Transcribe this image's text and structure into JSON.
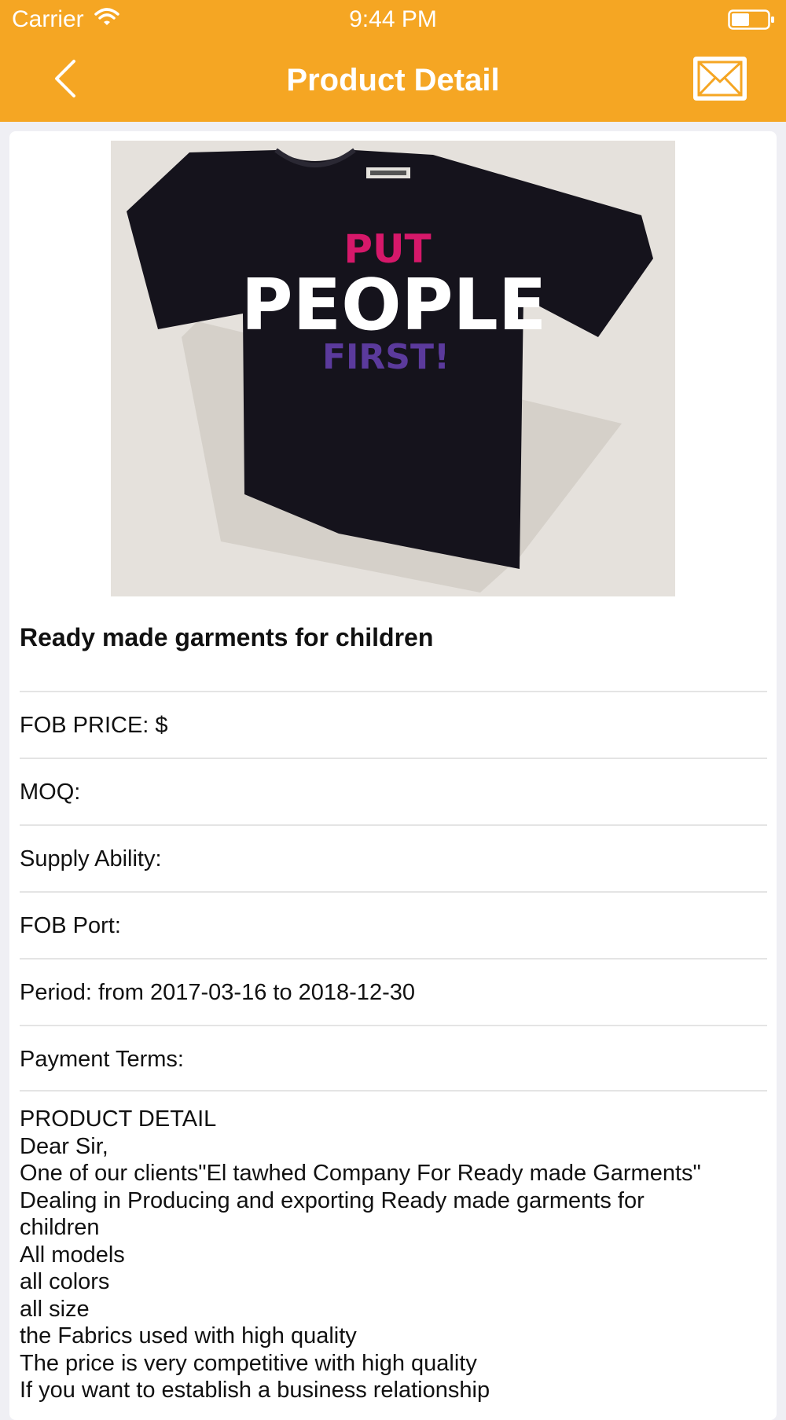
{
  "status_bar": {
    "carrier": "Carrier",
    "time": "9:44 PM"
  },
  "nav": {
    "title": "Product Detail",
    "back_icon": "chevron-left-icon",
    "mail_icon": "envelope-icon"
  },
  "colors": {
    "header": "#f5a623",
    "background": "#efeff4",
    "card": "#ffffff"
  },
  "product": {
    "image": {
      "shirt_text_top": "PUT",
      "shirt_text_middle": "PEOPLE",
      "shirt_text_bottom": "FIRST!"
    },
    "title": "Ready made garments for children",
    "fields": [
      {
        "label": "FOB PRICE: $"
      },
      {
        "label": "MOQ:"
      },
      {
        "label": "Supply Ability:"
      },
      {
        "label": "FOB Port:"
      },
      {
        "label": "Period: from 2017-03-16 to 2018-12-30"
      },
      {
        "label": "Payment Terms:"
      }
    ],
    "detail_lines": [
      "PRODUCT DETAIL",
      "Dear Sir,",
      "One of our clients\"El tawhed Company For Ready made Garments\"",
      "Dealing in Producing and exporting Ready made garments for",
      "children",
      "All models",
      "all colors",
      "all size",
      "the Fabrics used with high quality",
      "The price is very competitive with high quality",
      "If you want to establish a business relationship"
    ]
  }
}
